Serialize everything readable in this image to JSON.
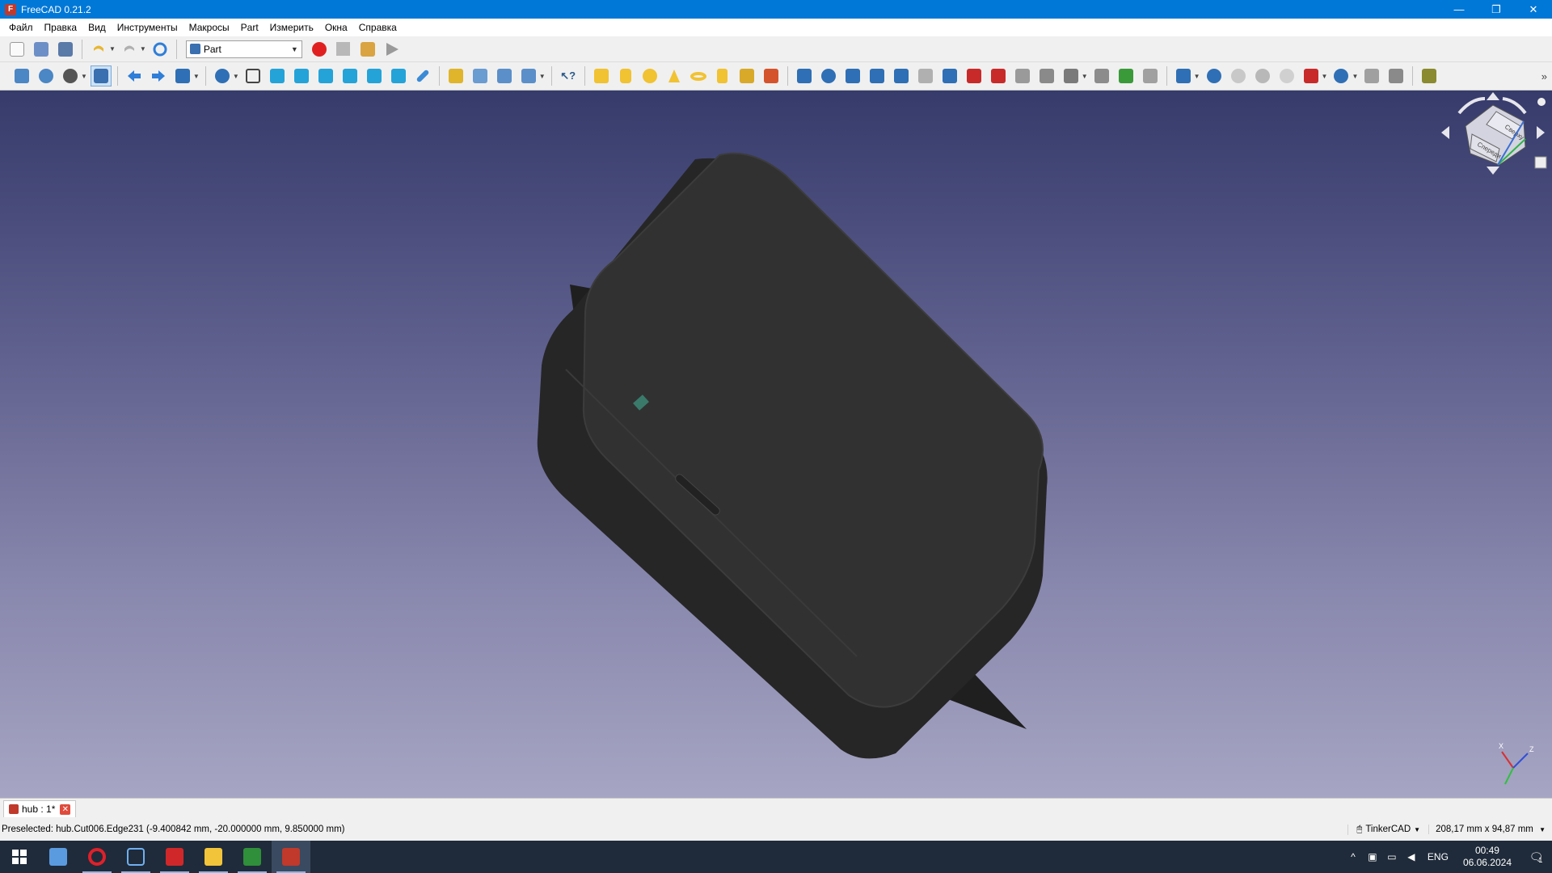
{
  "window": {
    "title": "FreeCAD 0.21.2",
    "minimize": "—",
    "maximize": "❐",
    "close": "✕"
  },
  "menu": [
    "Файл",
    "Правка",
    "Вид",
    "Инструменты",
    "Макросы",
    "Part",
    "Измерить",
    "Окна",
    "Справка"
  ],
  "workbench": {
    "selected": "Part"
  },
  "colors": {
    "titlebar": "#0078d7",
    "viewport_top": "#363b6b",
    "viewport_bottom": "#a6a5c3",
    "model": "#2e2e2e",
    "record": "#e02020"
  },
  "navcube": {
    "top_label": "Сверху",
    "front_label": "Спереди"
  },
  "axis": {
    "x": "X",
    "z": "Z"
  },
  "tabs": [
    {
      "label": "hub : 1*"
    }
  ],
  "status": {
    "preselected": "Preselected: hub.Cut006.Edge231 (-9.400842 mm, -20.000000 mm, 9.850000 mm)",
    "navigation": "TinkerCAD",
    "dimensions": "208,17 mm x 94,87 mm"
  },
  "taskbar": {
    "lang": "ENG",
    "time": "00:49",
    "date": "06.06.2024",
    "notifications": "1"
  }
}
